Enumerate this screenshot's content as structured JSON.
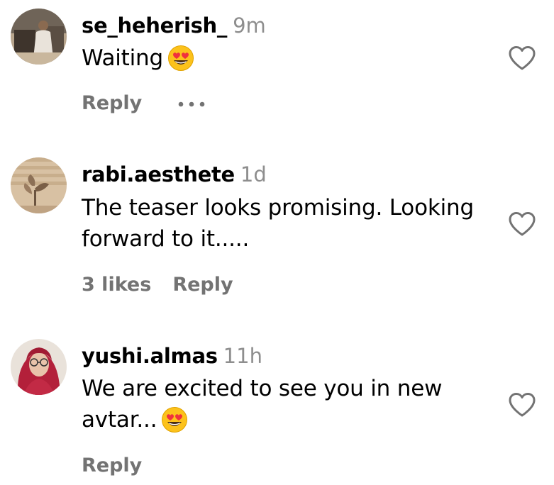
{
  "comments": [
    {
      "username": "se_heherish_",
      "time": "9m",
      "text": "Waiting",
      "emoji": "heart-eyes-emoji",
      "likes": "",
      "reply_label": "Reply",
      "has_more": true
    },
    {
      "username": "rabi.aesthete",
      "time": "1d",
      "text": "The teaser looks promising. Looking forward to it.....",
      "likes": "3 likes",
      "reply_label": "Reply"
    },
    {
      "username": "yushi.almas",
      "time": "11h",
      "text": "We are excited to see you in new avtar...",
      "emoji": "heart-eyes-emoji",
      "likes": "",
      "reply_label": "Reply"
    }
  ],
  "icons": {
    "like": "heart-outline-icon",
    "more": "more-options-icon"
  },
  "colors": {
    "secondary_text": "#8e8e8e",
    "action_text": "#737373",
    "icon_stroke": "#737373"
  }
}
